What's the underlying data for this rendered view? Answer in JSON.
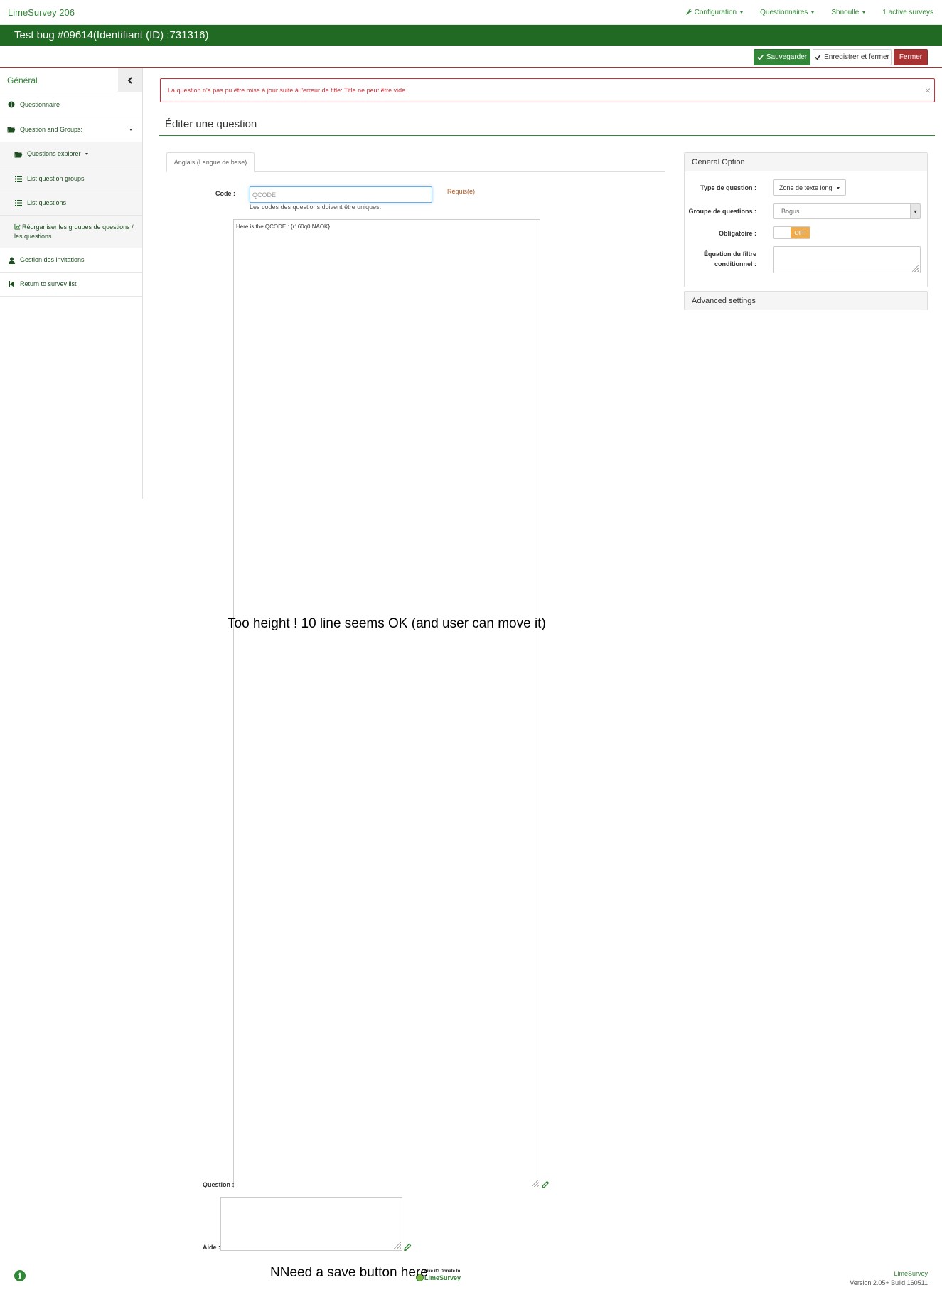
{
  "navbar": {
    "brand": "LimeSurvey 206",
    "items": [
      "Configuration",
      "Questionnaires",
      "Shnoulle",
      "1 active surveys"
    ]
  },
  "survey_bar": {
    "title": "Test bug #09614(Identifiant (ID) :731316)"
  },
  "toolbar": {
    "save_label": "Sauvegarder",
    "save_close_label": "Enregistrer et fermer",
    "close_label": "Fermer"
  },
  "sidebar": {
    "title": "Général",
    "items": [
      {
        "label": "Questionnaire",
        "icon": "info-circle-icon"
      },
      {
        "label": "Question and Groups:",
        "icon": "folder-open-icon"
      },
      {
        "label": "Questions explorer",
        "icon": "folder-open-icon"
      },
      {
        "label": "List question groups",
        "icon": "list-icon"
      },
      {
        "label": "List questions",
        "icon": "list-icon"
      },
      {
        "label": "Réorganiser les groupes de questions / les questions",
        "icon": "reorder-icon"
      },
      {
        "label": "Gestion des invitations",
        "icon": "user-icon"
      },
      {
        "label": "Return to survey list",
        "icon": "step-backward-icon"
      }
    ]
  },
  "alert": {
    "message": "La question n'a pas pu être mise à jour suite à l'erreur de title: Title ne peut être vide.",
    "close": "×"
  },
  "page": {
    "title": "Éditer une question"
  },
  "tabs": [
    {
      "label": "Anglais (Langue de base)"
    }
  ],
  "form": {
    "code_label": "Code :",
    "code_placeholder": "QCODE",
    "code_value": "",
    "required": "Requis(e)",
    "code_help": "Les codes des questions doivent être uniques.",
    "question_label": "Question :",
    "question_value": "Here is the QCODE : {r160q0.NAOK}",
    "help_label": "Aide :",
    "help_value": ""
  },
  "general_option": {
    "title": "General Option",
    "type_label": "Type de question :",
    "type_value": "Zone de texte long",
    "group_label": "Groupe de questions :",
    "group_value": "Bogus",
    "mandatory_label": "Obligatoire :",
    "mandatory_value": "OFF",
    "equation_label_1": "Équation du filtre",
    "equation_label_2": "conditionnel :"
  },
  "advanced": {
    "title": "Advanced settings"
  },
  "annotations": {
    "textarea_note": "Too height ! 10 line seems OK (and user can move it)",
    "save_note": "NNeed a save button here"
  },
  "footer": {
    "donate_line1": "Like it? Donate to",
    "donate_line2": "LimeSurvey",
    "right_line1": "LimeSurvey",
    "right_line2": "Version 2.05+ Build 160511"
  },
  "colors": {
    "brand_green": "#328637",
    "bar_green": "#216a23",
    "danger": "#a83232",
    "warning": "#f0ad4e"
  }
}
